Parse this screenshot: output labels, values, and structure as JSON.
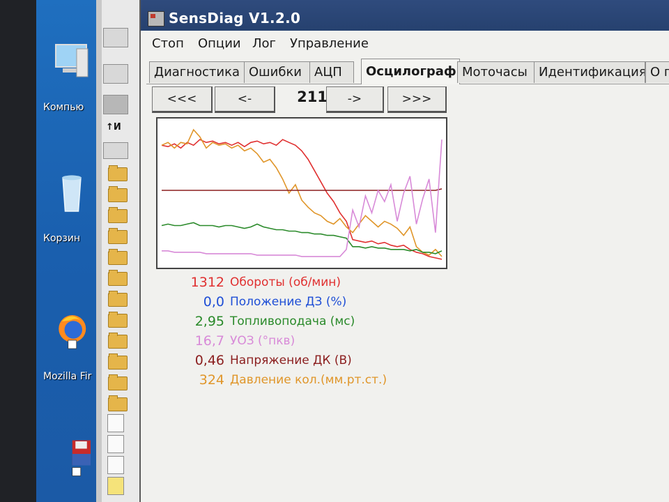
{
  "desktop": {
    "icons": [
      {
        "label": "Компью"
      },
      {
        "label": "Корзин"
      },
      {
        "label": "Mozilla Fir"
      },
      {
        "label": ""
      }
    ]
  },
  "window": {
    "title": "SensDiag V1.2.0"
  },
  "menu": [
    "Стоп",
    "Опции",
    "Лог",
    "Управление"
  ],
  "tabs": [
    {
      "label": "Диагностика",
      "active": false
    },
    {
      "label": "Ошибки",
      "active": false
    },
    {
      "label": "АЦП",
      "active": false
    },
    {
      "label": "Осцилограф",
      "active": true
    },
    {
      "label": "Моточасы",
      "active": false
    },
    {
      "label": "Идентификация",
      "active": false
    },
    {
      "label": "О п",
      "active": false
    }
  ],
  "nav": {
    "first": "<<<",
    "prev": "<-",
    "frame": "211",
    "next": "->",
    "last": ">>>"
  },
  "colors": {
    "rpm": "#e03030",
    "throttle": "#1f4fd6",
    "fuel": "#2a8a2a",
    "uoz": "#d88ad8",
    "dk": "#8b1e1e",
    "pressure": "#e0962a"
  },
  "legend": [
    {
      "value": "1312",
      "label": "Обороты (об/мин)",
      "color": "#e03030"
    },
    {
      "value": "0,0",
      "label": "Положение ДЗ (%)",
      "color": "#1f4fd6"
    },
    {
      "value": "2,95",
      "label": "Топливоподача (мс)",
      "color": "#2a8a2a"
    },
    {
      "value": "16,7",
      "label": "УОЗ (°пкв)",
      "color": "#d88ad8"
    },
    {
      "value": "0,46",
      "label": "Напряжение ДК (В)",
      "color": "#8b1e1e"
    },
    {
      "value": "324",
      "label": "Давление кол.(мм.рт.ст.)",
      "color": "#e0962a"
    }
  ],
  "chart_data": {
    "type": "line",
    "xlabel": "",
    "ylabel": "",
    "ylim": [
      0,
      1
    ],
    "series": [
      {
        "color": "#e03030",
        "values": [
          0.84,
          0.83,
          0.85,
          0.82,
          0.86,
          0.84,
          0.88,
          0.86,
          0.87,
          0.85,
          0.86,
          0.84,
          0.86,
          0.83,
          0.86,
          0.87,
          0.85,
          0.86,
          0.84,
          0.88,
          0.86,
          0.84,
          0.8,
          0.74,
          0.66,
          0.58,
          0.5,
          0.44,
          0.36,
          0.3,
          0.17,
          0.16,
          0.15,
          0.16,
          0.14,
          0.15,
          0.13,
          0.12,
          0.13,
          0.1,
          0.08,
          0.07,
          0.05,
          0.04,
          0.03
        ]
      },
      {
        "color": "#e0962a",
        "values": [
          0.84,
          0.86,
          0.82,
          0.86,
          0.85,
          0.95,
          0.9,
          0.82,
          0.86,
          0.84,
          0.85,
          0.82,
          0.84,
          0.8,
          0.82,
          0.78,
          0.72,
          0.74,
          0.68,
          0.6,
          0.5,
          0.56,
          0.45,
          0.4,
          0.36,
          0.34,
          0.3,
          0.28,
          0.32,
          0.26,
          0.22,
          0.28,
          0.34,
          0.3,
          0.26,
          0.3,
          0.28,
          0.25,
          0.2,
          0.26,
          0.12,
          0.08,
          0.06,
          0.1,
          0.05
        ]
      },
      {
        "color": "#8b1e1e",
        "values": [
          0.52,
          0.52,
          0.52,
          0.52,
          0.52,
          0.52,
          0.52,
          0.52,
          0.52,
          0.52,
          0.52,
          0.52,
          0.52,
          0.52,
          0.52,
          0.52,
          0.52,
          0.52,
          0.52,
          0.52,
          0.52,
          0.52,
          0.52,
          0.52,
          0.52,
          0.52,
          0.52,
          0.52,
          0.52,
          0.52,
          0.52,
          0.52,
          0.52,
          0.52,
          0.52,
          0.52,
          0.52,
          0.52,
          0.52,
          0.52,
          0.52,
          0.52,
          0.52,
          0.52,
          0.53
        ]
      },
      {
        "color": "#2a8a2a",
        "values": [
          0.27,
          0.28,
          0.27,
          0.27,
          0.28,
          0.29,
          0.27,
          0.27,
          0.27,
          0.26,
          0.27,
          0.27,
          0.26,
          0.25,
          0.26,
          0.28,
          0.26,
          0.25,
          0.24,
          0.24,
          0.23,
          0.23,
          0.22,
          0.22,
          0.21,
          0.21,
          0.2,
          0.2,
          0.19,
          0.18,
          0.12,
          0.12,
          0.11,
          0.12,
          0.11,
          0.11,
          0.1,
          0.1,
          0.1,
          0.09,
          0.1,
          0.08,
          0.08,
          0.07,
          0.09
        ]
      },
      {
        "color": "#d88ad8",
        "values": [
          0.09,
          0.09,
          0.08,
          0.08,
          0.08,
          0.08,
          0.08,
          0.07,
          0.07,
          0.07,
          0.07,
          0.07,
          0.07,
          0.07,
          0.07,
          0.06,
          0.06,
          0.06,
          0.06,
          0.06,
          0.06,
          0.06,
          0.05,
          0.05,
          0.05,
          0.05,
          0.05,
          0.05,
          0.05,
          0.1,
          0.38,
          0.26,
          0.48,
          0.36,
          0.52,
          0.44,
          0.56,
          0.3,
          0.5,
          0.62,
          0.28,
          0.46,
          0.6,
          0.22,
          0.88
        ]
      }
    ]
  }
}
